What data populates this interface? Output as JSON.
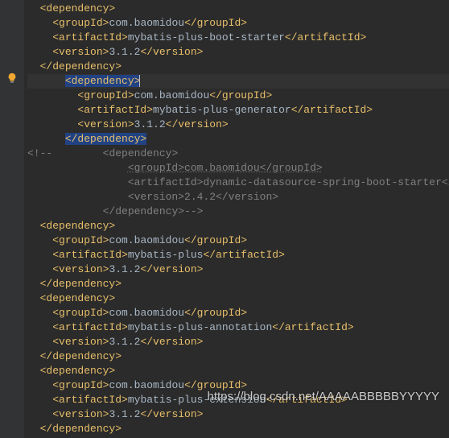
{
  "indent": {
    "i2": "  ",
    "i3": "    ",
    "i4": "      ",
    "i5": "        "
  },
  "dep1": {
    "open": "<dependency>",
    "groupIdOpen": "<groupId>",
    "groupIdVal": "com.baomidou",
    "groupIdClose": "</groupId>",
    "artifactIdOpen": "<artifactId>",
    "artifactIdVal": "mybatis-plus-boot-starter",
    "artifactIdClose": "</artifactId>",
    "versionOpen": "<version>",
    "versionVal": "3.1.2",
    "versionClose": "</version>",
    "close": "</dependency>"
  },
  "dep2": {
    "open": "<dependency>",
    "groupIdOpen": "<groupId>",
    "groupIdVal": "com.baomidou",
    "groupIdClose": "</groupId>",
    "artifactIdOpen": "<artifactId>",
    "artifactIdVal": "mybatis-plus-generator",
    "artifactIdClose": "</artifactId>",
    "versionOpen": "<version>",
    "versionVal": "3.1.2",
    "versionClose": "</version>",
    "close": "</dependency>"
  },
  "comment": {
    "open": "<!--",
    "depOpen": "<dependency>",
    "groupId": "<groupId>com.baomidou</groupId>",
    "artifactId": "<artifactId>dynamic-datasource-spring-boot-starter</artifactId>",
    "version": "<version>2.4.2</version>",
    "depClose": "</dependency>",
    "close": "-->"
  },
  "dep3": {
    "open": "<dependency>",
    "groupIdOpen": "<groupId>",
    "groupIdVal": "com.baomidou",
    "groupIdClose": "</groupId>",
    "artifactIdOpen": "<artifactId>",
    "artifactIdVal": "mybatis-plus",
    "artifactIdClose": "</artifactId>",
    "versionOpen": "<version>",
    "versionVal": "3.1.2",
    "versionClose": "</version>",
    "close": "</dependency>"
  },
  "dep4": {
    "open": "<dependency>",
    "groupIdOpen": "<groupId>",
    "groupIdVal": "com.baomidou",
    "groupIdClose": "</groupId>",
    "artifactIdOpen": "<artifactId>",
    "artifactIdVal": "mybatis-plus-annotation",
    "artifactIdClose": "</artifactId>",
    "versionOpen": "<version>",
    "versionVal": "3.1.2",
    "versionClose": "</version>",
    "close": "</dependency>"
  },
  "dep5": {
    "open": "<dependency>",
    "groupIdOpen": "<groupId>",
    "groupIdVal": "com.baomidou",
    "groupIdClose": "</groupId>",
    "artifactIdOpen": "<artifactId>",
    "artifactIdVal": "mybatis-plus-extension",
    "artifactIdClose": "</artifactId>",
    "versionOpen": "<version>",
    "versionVal": "3.1.2",
    "versionClose": "</version>",
    "close": "</dependency>"
  },
  "watermark": "https://blog.csdn.net/AAAAABBBBBYYYYY"
}
